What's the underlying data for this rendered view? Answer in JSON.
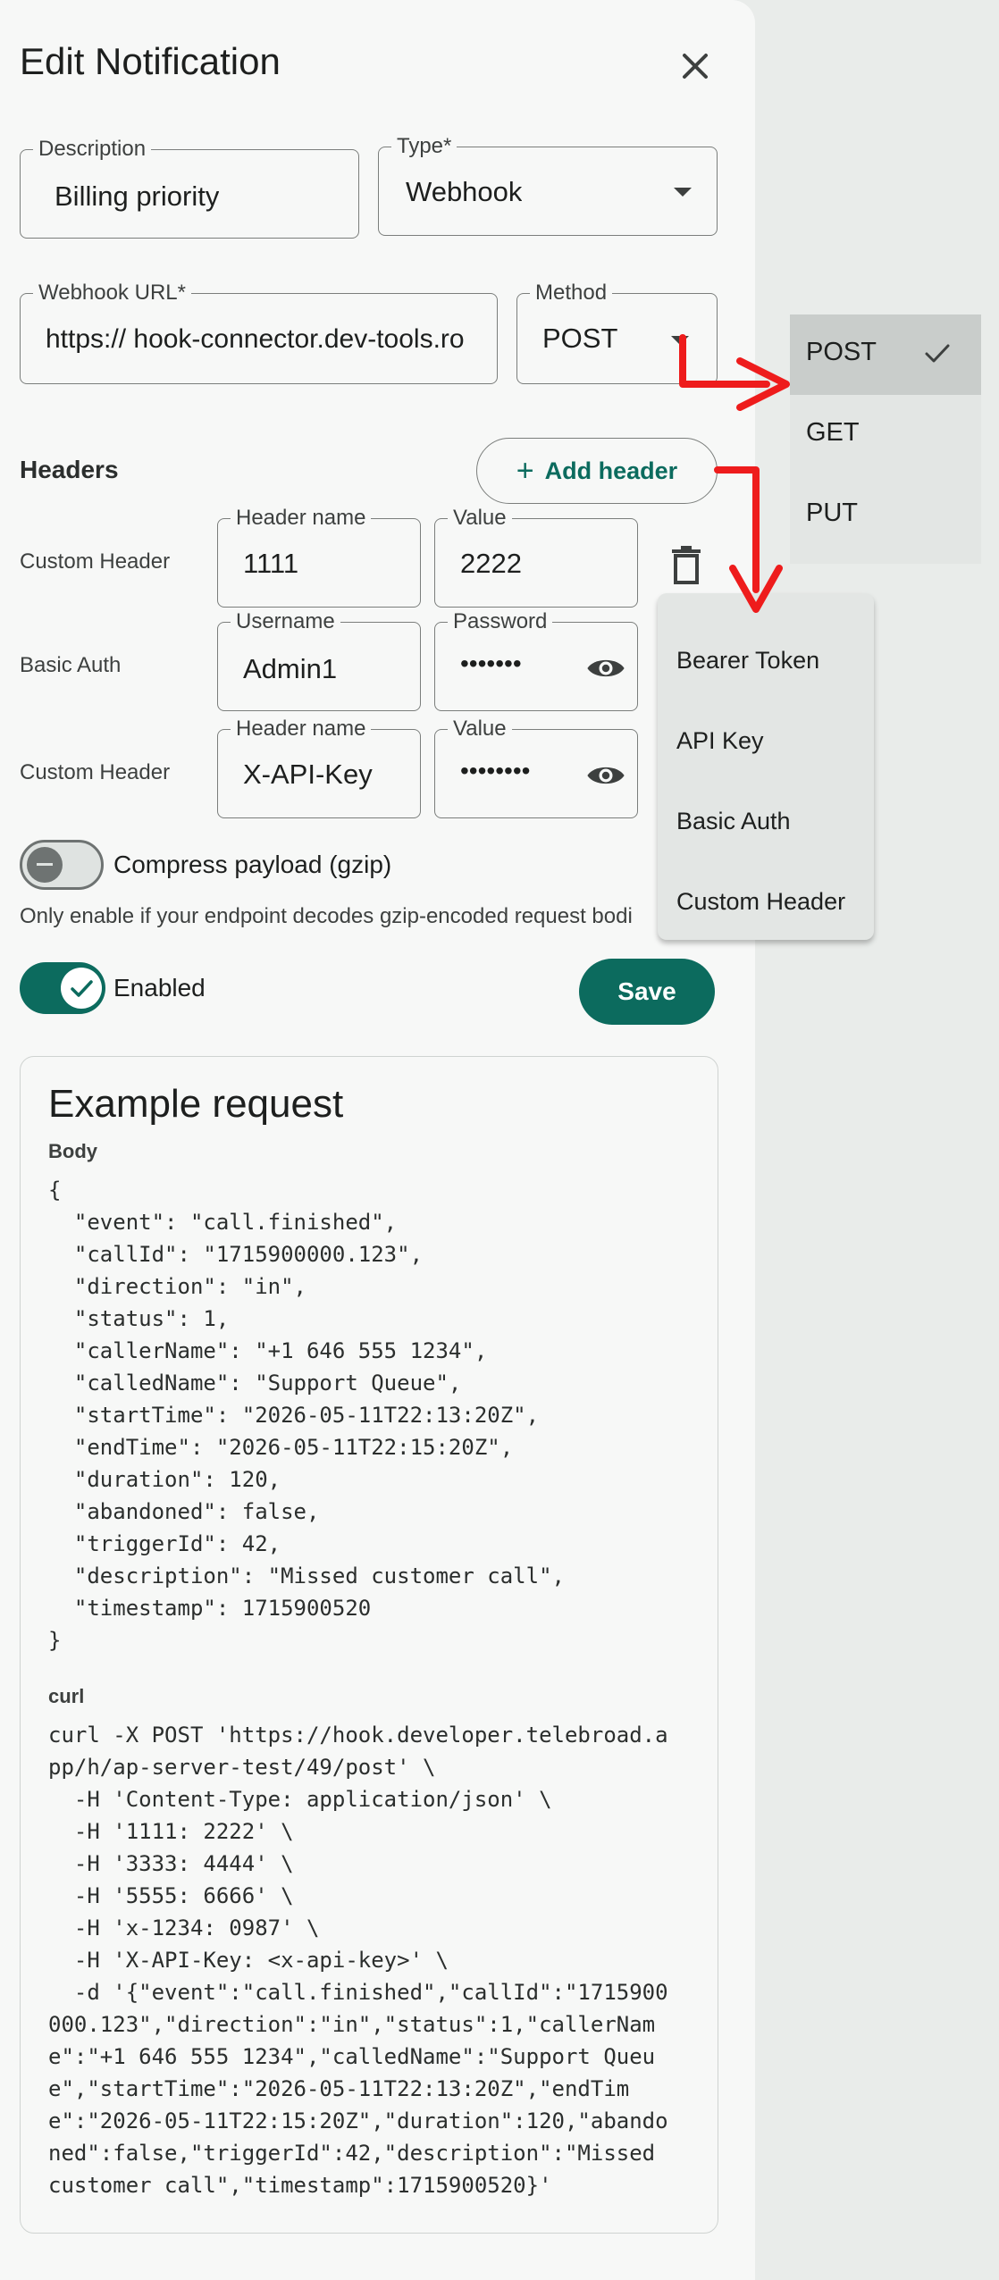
{
  "dialog": {
    "title": "Edit Notification"
  },
  "description": {
    "label": "Description",
    "value": "Billing priority"
  },
  "type": {
    "label": "Type*",
    "value": "Webhook"
  },
  "webhook_url": {
    "label": "Webhook URL*",
    "value": "https:// hook-connector.dev-tools.ro"
  },
  "method": {
    "label": "Method",
    "value": "POST"
  },
  "headers": {
    "title": "Headers",
    "add_label": "Add header",
    "rows": [
      {
        "type_label": "Custom Header",
        "name_label": "Header name",
        "name_value": "1111",
        "value_label": "Value",
        "value_value": "2222"
      },
      {
        "type_label": "Basic Auth",
        "name_label": "Username",
        "name_value": "Admin1",
        "value_label": "Password",
        "value_value": "•••••••"
      },
      {
        "type_label": "Custom Header",
        "name_label": "Header name",
        "name_value": "X-API-Key",
        "value_label": "Value",
        "value_value": "••••••••"
      }
    ]
  },
  "compress": {
    "label": "Compress payload (gzip)",
    "checked": false,
    "hint": "Only enable if your endpoint decodes gzip-encoded request bodi"
  },
  "enabled": {
    "label": "Enabled",
    "checked": true
  },
  "save_label": "Save",
  "example": {
    "title": "Example request",
    "body_label": "Body",
    "body": "{\n  \"event\": \"call.finished\",\n  \"callId\": \"1715900000.123\",\n  \"direction\": \"in\",\n  \"status\": 1,\n  \"callerName\": \"+1 646 555 1234\",\n  \"calledName\": \"Support Queue\",\n  \"startTime\": \"2026-05-11T22:13:20Z\",\n  \"endTime\": \"2026-05-11T22:15:20Z\",\n  \"duration\": 120,\n  \"abandoned\": false,\n  \"triggerId\": 42,\n  \"description\": \"Missed customer call\",\n  \"timestamp\": 1715900520\n}",
    "curl_label": "curl",
    "curl": "curl -X POST 'https://hook.developer.telebroad.a\npp/h/ap-server-test/49/post' \\\n  -H 'Content-Type: application/json' \\\n  -H '1111: 2222' \\\n  -H '3333: 4444' \\\n  -H '5555: 6666' \\\n  -H 'x-1234: 0987' \\\n  -H 'X-API-Key: <x-api-key>' \\\n  -d '{\"event\":\"call.finished\",\"callId\":\"1715900\n000.123\",\"direction\":\"in\",\"status\":1,\"callerNam\ne\":\"+1 646 555 1234\",\"calledName\":\"Support Queu\ne\",\"startTime\":\"2026-05-11T22:13:20Z\",\"endTim\ne\":\"2026-05-11T22:15:20Z\",\"duration\":120,\"abando\nned\":false,\"triggerId\":42,\"description\":\"Missed\ncustomer call\",\"timestamp\":1715900520}'"
  },
  "method_menu": {
    "items": [
      "POST",
      "GET",
      "PUT"
    ],
    "selected": "POST"
  },
  "header_menu": {
    "items": [
      "Bearer Token",
      "API Key",
      "Basic Auth",
      "Custom Header"
    ]
  },
  "colors": {
    "accent": "#0c6b5e",
    "arrow": "#ee1c1c"
  }
}
